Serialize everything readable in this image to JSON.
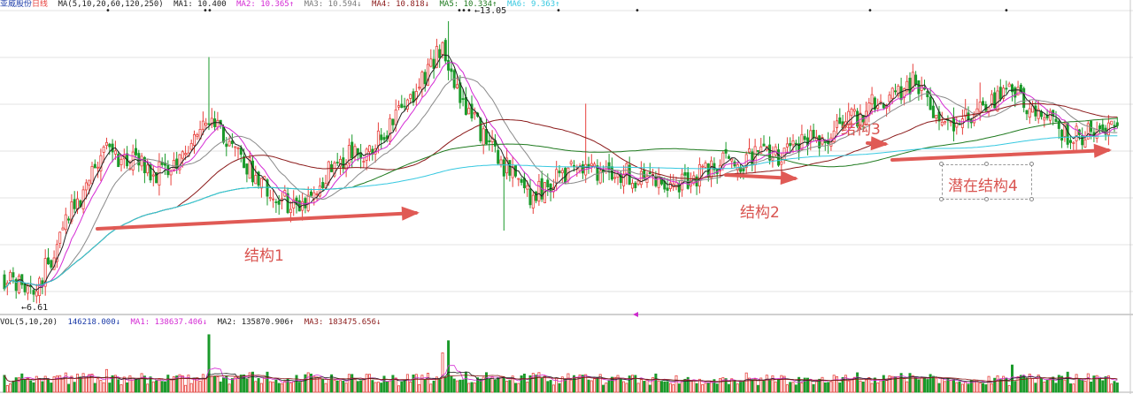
{
  "colors": {
    "up": "#e8413d",
    "down": "#1a9a2a",
    "ma1": "#202020",
    "ma2": "#d42ad4",
    "ma3": "#8a8a8a",
    "ma4": "#8b1a1a",
    "ma5": "#1f7a1f",
    "ma6": "#35c8e0",
    "arrow": "#e05a55",
    "grid": "#e3e3e3"
  },
  "header": {
    "stock_name": "亚威股份",
    "period": "日线",
    "ma_label": "MA(5,10,20,60,120,250)",
    "ma1": "MA1: 10.400",
    "ma2": "MA2: 10.365↑",
    "ma3": "MA3: 10.594↓",
    "ma4": "MA4: 10.818↓",
    "ma5": "MA5: 10.334↑",
    "ma6": "MA6: 9.363↑"
  },
  "volume_header": {
    "label": "VOL(5,10,20)",
    "vol": "146218.000↓",
    "ma1": "MA1: 138637.406↓",
    "ma2": "MA2: 135870.906↑",
    "ma3": "MA3: 183475.656↓"
  },
  "price_labels": {
    "high": "13.05",
    "low": "6.61"
  },
  "annotations": {
    "s1": "结构1",
    "s2": "结构2",
    "s3": "结构3",
    "s4": "潜在结构4"
  },
  "chart_data": {
    "type": "candlestick",
    "ylim": [
      6.2,
      13.3
    ],
    "volume_ylim": [
      0,
      420000
    ],
    "grid": true,
    "keypoints": [
      {
        "i": 0,
        "p": 7.0
      },
      {
        "i": 10,
        "p": 6.6
      },
      {
        "i": 22,
        "p": 8.4
      },
      {
        "i": 35,
        "p": 10.0
      },
      {
        "i": 55,
        "p": 9.4
      },
      {
        "i": 70,
        "p": 10.7
      },
      {
        "i": 90,
        "p": 9.1
      },
      {
        "i": 100,
        "p": 8.6
      },
      {
        "i": 115,
        "p": 9.8
      },
      {
        "i": 125,
        "p": 10.0
      },
      {
        "i": 135,
        "p": 10.8
      },
      {
        "i": 150,
        "p": 12.5
      },
      {
        "i": 155,
        "p": 11.4
      },
      {
        "i": 170,
        "p": 9.7
      },
      {
        "i": 180,
        "p": 8.9
      },
      {
        "i": 195,
        "p": 9.6
      },
      {
        "i": 210,
        "p": 9.5
      },
      {
        "i": 228,
        "p": 9.1
      },
      {
        "i": 245,
        "p": 9.7
      },
      {
        "i": 265,
        "p": 9.9
      },
      {
        "i": 285,
        "p": 10.5
      },
      {
        "i": 300,
        "p": 11.2
      },
      {
        "i": 312,
        "p": 11.6
      },
      {
        "i": 322,
        "p": 10.6
      },
      {
        "i": 345,
        "p": 11.4
      },
      {
        "i": 365,
        "p": 10.3
      },
      {
        "i": 381,
        "p": 10.5
      }
    ],
    "spikes": [
      {
        "i": 70,
        "p": 12.2
      },
      {
        "i": 152,
        "p": 13.05
      },
      {
        "i": 199,
        "p": 11.1
      },
      {
        "i": 171,
        "p": 8.1
      },
      {
        "i": 334,
        "p": 11.6
      }
    ],
    "volume_peaks": [
      {
        "i": 70,
        "v": 380000
      },
      {
        "i": 152,
        "v": 340000
      },
      {
        "i": 150,
        "v": 260000
      },
      {
        "i": 345,
        "v": 180000
      },
      {
        "i": 35,
        "v": 150000
      },
      {
        "i": 105,
        "v": 120000
      }
    ]
  }
}
